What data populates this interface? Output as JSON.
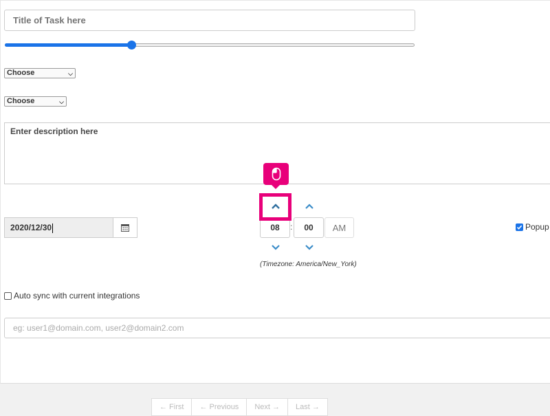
{
  "form": {
    "title_placeholder": "Title of Task here",
    "slider_value_percent": 31,
    "select_1": "Choose",
    "select_2": "Choose",
    "description_placeholder": "Enter description here",
    "date_value": "2020/12/30",
    "time": {
      "hour": "08",
      "minute": "00",
      "separator": ":",
      "period": "AM"
    },
    "timezone": "(Timezone: America/New_York)",
    "popup_label": "Popup",
    "popup_checked": true,
    "autosync_label": "Auto sync with current integrations",
    "autosync_checked": false,
    "email_placeholder": "eg: user1@domain.com, user2@domain2.com"
  },
  "pager": {
    "first": "← First",
    "previous": "← Previous",
    "next": "Next →",
    "last": "Last →"
  },
  "icons": {
    "calendar": "calendar-icon",
    "up": "chevron-up-icon",
    "down": "chevron-down-icon",
    "cursor": "mouse-icon"
  },
  "colors": {
    "accent": "#1a73e8",
    "spinner": "#3a8cc8",
    "highlight": "#e8007a"
  }
}
